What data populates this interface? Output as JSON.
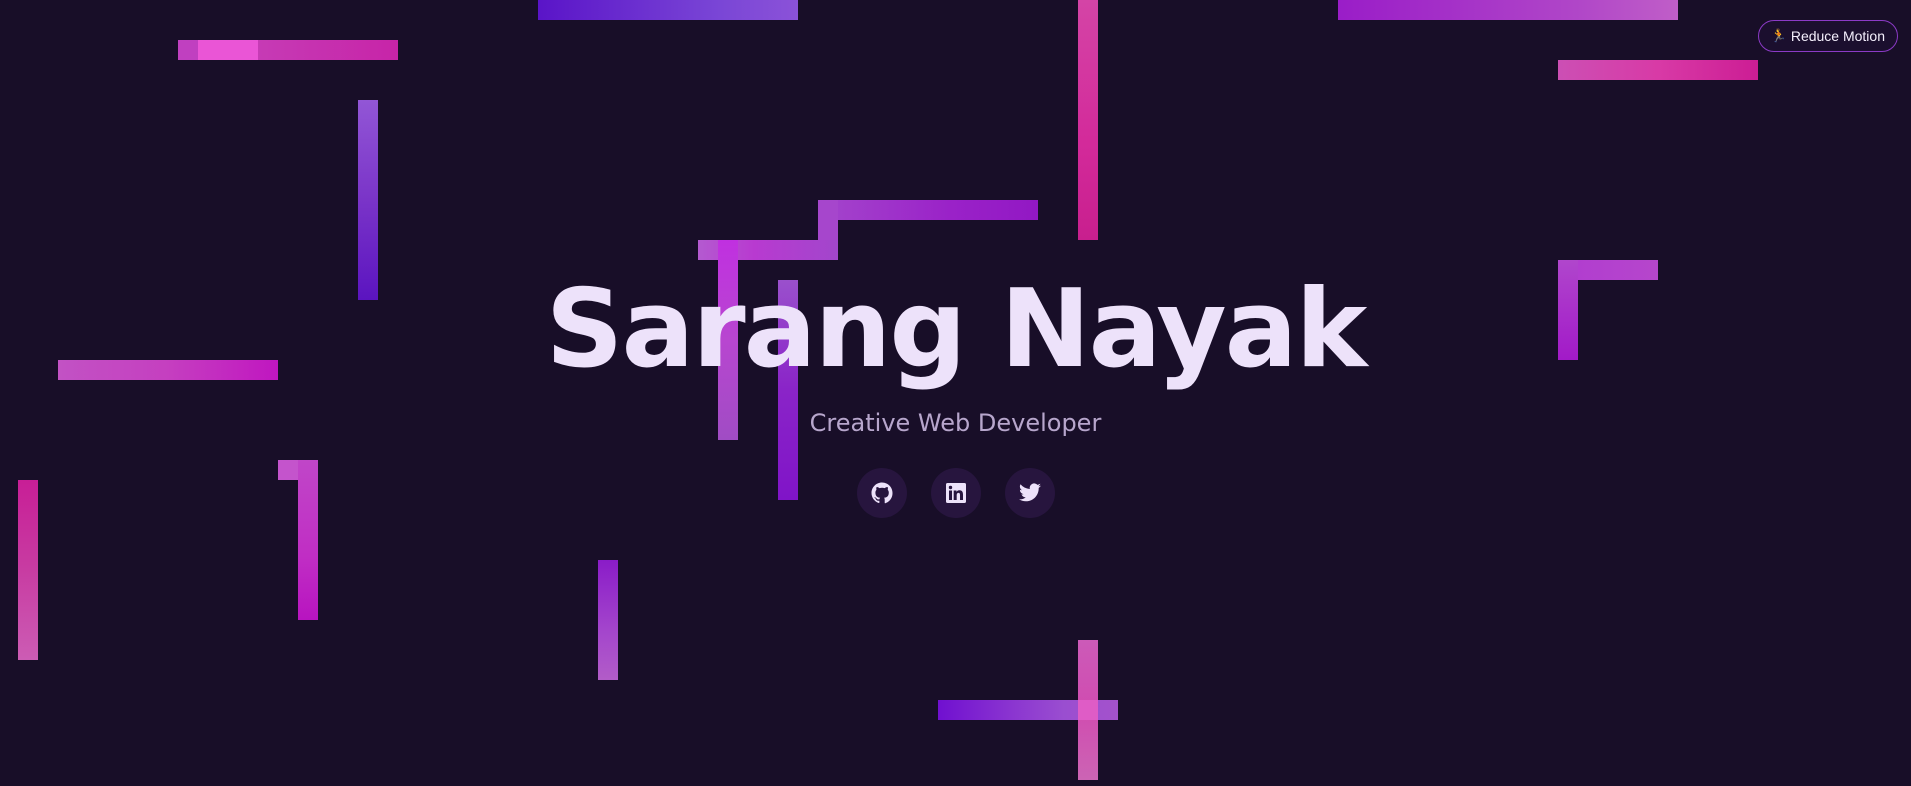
{
  "hero": {
    "name": "Sarang Nayak",
    "tagline": "Creative Web Developer"
  },
  "socials": [
    {
      "name": "github-icon",
      "label": "GitHub"
    },
    {
      "name": "linkedin-icon",
      "label": "LinkedIn"
    },
    {
      "name": "twitter-icon",
      "label": "Twitter"
    }
  ],
  "controls": {
    "reduce_motion_label": "Reduce Motion",
    "reduce_motion_icon": "running-person-icon"
  },
  "colors": {
    "background": "#180e28",
    "title": "#ede2fa",
    "subtitle": "#b7a6cc",
    "accent_magenta": "#d32a9a",
    "accent_purple": "#8a24c8"
  }
}
